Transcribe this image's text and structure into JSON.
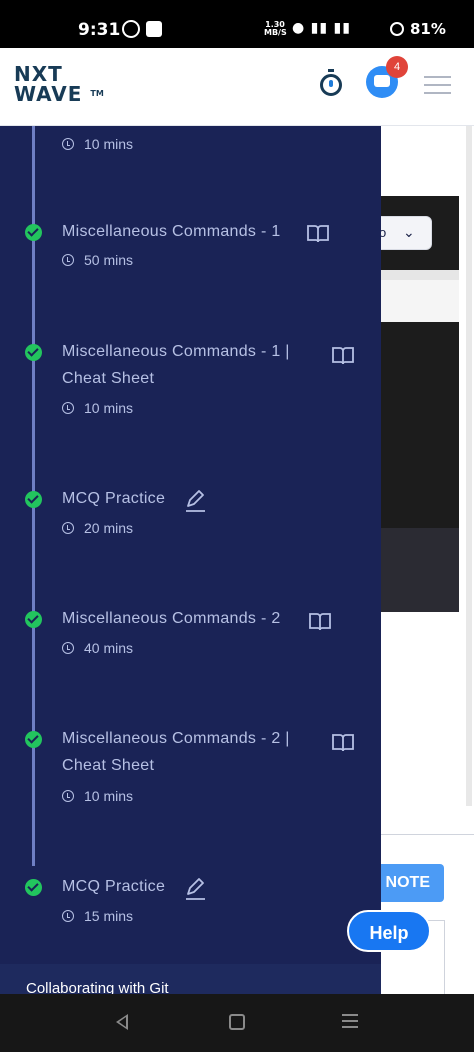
{
  "status_bar": {
    "time": "9:31",
    "speed_value": "1.30",
    "speed_unit": "MB/S",
    "battery": "81%"
  },
  "header": {
    "logo_line1": "NXT",
    "logo_line2": "WAVE",
    "logo_tm": "TM",
    "notification_count": "4"
  },
  "drawer": {
    "top_partial_duration": "10 mins",
    "items": [
      {
        "title": "Miscellaneous Commands - 1",
        "duration": "50 mins",
        "icon": "book-icon",
        "completed": true
      },
      {
        "title": "Miscellaneous Commands - 1 | Cheat Sheet",
        "duration": "10 mins",
        "icon": "book-icon",
        "completed": true
      },
      {
        "title": "MCQ Practice",
        "duration": "20 mins",
        "icon": "edit-icon",
        "completed": true
      },
      {
        "title": "Miscellaneous Commands - 2",
        "duration": "40 mins",
        "icon": "book-icon",
        "completed": true
      },
      {
        "title": "Miscellaneous Commands - 2 | Cheat Sheet",
        "duration": "10 mins",
        "icon": "book-icon",
        "completed": true
      },
      {
        "title": "MCQ Practice",
        "duration": "15 mins",
        "icon": "edit-icon",
        "completed": true
      }
    ],
    "next_section": "Collaborating with Git"
  },
  "background": {
    "note_button": "NOTE",
    "select_partial": "o"
  },
  "help_button": "Help",
  "colors": {
    "drawer_bg": "#1a2356",
    "check_green": "#22c55e",
    "help_blue": "#1877f2",
    "badge_red": "#e0443a"
  }
}
